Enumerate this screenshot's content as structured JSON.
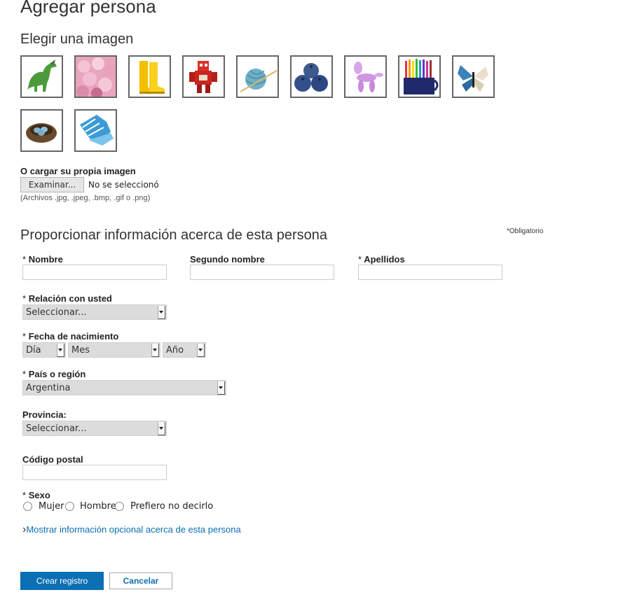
{
  "page": {
    "title": "Agregar persona"
  },
  "image_section": {
    "heading": "Elegir una imagen",
    "thumbnails": [
      {
        "name": "dinosaur-thumbnail"
      },
      {
        "name": "flower-petals-thumbnail"
      },
      {
        "name": "rain-boots-thumbnail"
      },
      {
        "name": "robot-thumbnail"
      },
      {
        "name": "yarn-ball-thumbnail"
      },
      {
        "name": "blueberries-thumbnail"
      },
      {
        "name": "balloon-animal-thumbnail"
      },
      {
        "name": "colored-pencils-thumbnail"
      },
      {
        "name": "butterfly-thumbnail"
      },
      {
        "name": "bird-nest-thumbnail"
      },
      {
        "name": "gloves-thumbnail"
      }
    ],
    "upload_label": "O cargar su propia imagen",
    "browse_button": "Examinar...",
    "no_file_text": "No se seleccionó",
    "file_types_hint": "(Archivos .jpg, .jpeg, .bmp, .gif o .png)"
  },
  "info_section": {
    "heading": "Proporcionar información acerca de esta persona",
    "required_note": "*Obligatorio"
  },
  "fields": {
    "required_marker": "*",
    "first_name": {
      "label": "Nombre",
      "value": ""
    },
    "middle_name": {
      "label": "Segundo nombre",
      "value": ""
    },
    "last_name": {
      "label": "Apellidos",
      "value": ""
    },
    "relationship": {
      "label": "Relación con usted",
      "selected": "Seleccionar..."
    },
    "birth_date": {
      "label": "Fecha de nacimiento",
      "day_selected": "Día",
      "month_selected": "Mes",
      "year_selected": "Año"
    },
    "country": {
      "label": "País o región",
      "selected": "Argentina"
    },
    "province": {
      "label": "Provincia:",
      "selected": "Seleccionar..."
    },
    "postal_code": {
      "label": "Código postal",
      "value": ""
    },
    "sex": {
      "label": "Sexo",
      "options": [
        "Mujer",
        "Hombre",
        "Prefiero no decirlo"
      ]
    }
  },
  "optional_link": {
    "chevron": "›",
    "text": "Mostrar información opcional acerca de esta persona"
  },
  "actions": {
    "submit": "Crear registro",
    "cancel": "Cancelar"
  },
  "colors": {
    "primary": "#0b6fb4",
    "link": "#0b6fb4"
  }
}
